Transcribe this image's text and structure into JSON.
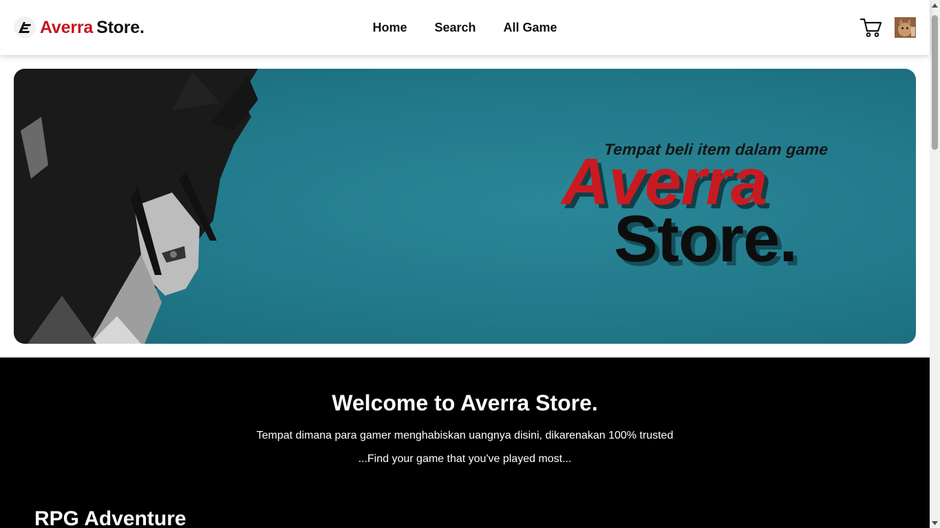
{
  "brand": {
    "name_part1": "Averra",
    "name_part2": "Store.",
    "logo_icon": "averra-logo-icon"
  },
  "nav": {
    "items": [
      {
        "label": "Home"
      },
      {
        "label": "Search"
      },
      {
        "label": "All Game"
      }
    ]
  },
  "header_actions": {
    "cart_icon": "shopping-cart-icon",
    "avatar": "user-avatar"
  },
  "hero": {
    "tagline": "Tempat beli item dalam game",
    "title_line1": "Averra",
    "title_line2": "Store."
  },
  "welcome": {
    "title": "Welcome to Averra Store.",
    "subtitle": "Tempat dimana para gamer menghabiskan uangnya disini, dikarenakan 100% trusted",
    "subtitle2": "...Find your game that you've played most...",
    "section_heading": "RPG Adventure"
  },
  "colors": {
    "brand_red": "#c0181e",
    "hero_teal": "#21798a",
    "welcome_bg": "#000000"
  }
}
